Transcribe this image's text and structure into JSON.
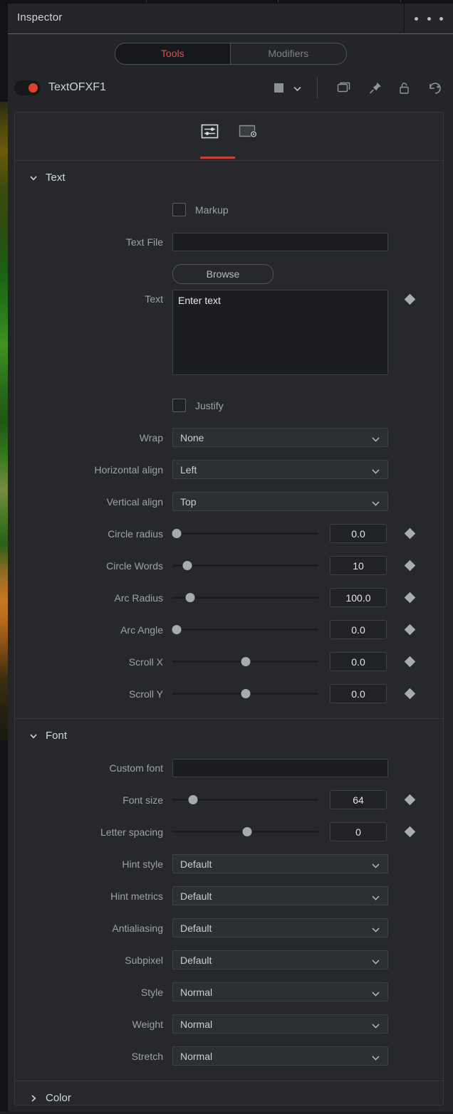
{
  "window": {
    "accent_red": "#cb4034",
    "panel_bg": "#232529",
    "card_bg": "#26282c"
  },
  "titlebar": {
    "title": "Inspector",
    "overflow_menu": "more-options"
  },
  "mode_tabs": {
    "items": [
      {
        "label": "Tools",
        "active": true
      },
      {
        "label": "Modifiers",
        "active": false
      }
    ]
  },
  "node": {
    "name": "TextOFXF1",
    "enabled": true,
    "color_swatch": "#8d9196",
    "icons": [
      "copy-icon",
      "pin-icon",
      "lock-icon",
      "reset-icon"
    ]
  },
  "sub_tabs": {
    "items": [
      {
        "icon": "sliders-icon",
        "active": true
      },
      {
        "icon": "settings-image-icon",
        "active": false
      }
    ]
  },
  "sections": [
    {
      "id": "text",
      "label": "Text",
      "expanded": true,
      "rows": [
        {
          "type": "checkbox",
          "label": "Markup",
          "checked": false,
          "keyframe": false
        },
        {
          "type": "text",
          "label": "Text File",
          "value": "",
          "keyframe": false
        },
        {
          "type": "button",
          "label": "",
          "button_label": "Browse"
        },
        {
          "type": "textarea",
          "label": "Text",
          "value": "Enter text",
          "keyframe": true
        },
        {
          "type": "checkbox",
          "label": "Justify",
          "checked": false,
          "keyframe": false
        },
        {
          "type": "select",
          "label": "Wrap",
          "value": "None",
          "keyframe": false
        },
        {
          "type": "select",
          "label": "Horizontal align",
          "value": "Left",
          "keyframe": false
        },
        {
          "type": "select",
          "label": "Vertical align",
          "value": "Top",
          "keyframe": false
        },
        {
          "type": "slider",
          "label": "Circle radius",
          "value": "0.0",
          "pos": 3,
          "keyframe": true
        },
        {
          "type": "slider",
          "label": "Circle Words",
          "value": "10",
          "pos": 10,
          "keyframe": true
        },
        {
          "type": "slider",
          "label": "Arc Radius",
          "value": "100.0",
          "pos": 12,
          "keyframe": true
        },
        {
          "type": "slider",
          "label": "Arc Angle",
          "value": "0.0",
          "pos": 3,
          "keyframe": true
        },
        {
          "type": "slider",
          "label": "Scroll X",
          "value": "0.0",
          "pos": 50,
          "keyframe": true
        },
        {
          "type": "slider",
          "label": "Scroll Y",
          "value": "0.0",
          "pos": 50,
          "keyframe": true
        }
      ]
    },
    {
      "id": "font",
      "label": "Font",
      "expanded": true,
      "rows": [
        {
          "type": "text",
          "label": "Custom font",
          "value": "",
          "keyframe": false
        },
        {
          "type": "slider",
          "label": "Font size",
          "value": "64",
          "pos": 14,
          "keyframe": true
        },
        {
          "type": "slider",
          "label": "Letter spacing",
          "value": "0",
          "pos": 51,
          "keyframe": true
        },
        {
          "type": "select",
          "label": "Hint style",
          "value": "Default",
          "keyframe": false
        },
        {
          "type": "select",
          "label": "Hint metrics",
          "value": "Default",
          "keyframe": false
        },
        {
          "type": "select",
          "label": "Antialiasing",
          "value": "Default",
          "keyframe": false
        },
        {
          "type": "select",
          "label": "Subpixel",
          "value": "Default",
          "keyframe": false
        },
        {
          "type": "select",
          "label": "Style",
          "value": "Normal",
          "keyframe": false
        },
        {
          "type": "select",
          "label": "Weight",
          "value": "Normal",
          "keyframe": false
        },
        {
          "type": "select",
          "label": "Stretch",
          "value": "Normal",
          "keyframe": false
        }
      ]
    },
    {
      "id": "color",
      "label": "Color",
      "expanded": false,
      "rows": []
    }
  ]
}
